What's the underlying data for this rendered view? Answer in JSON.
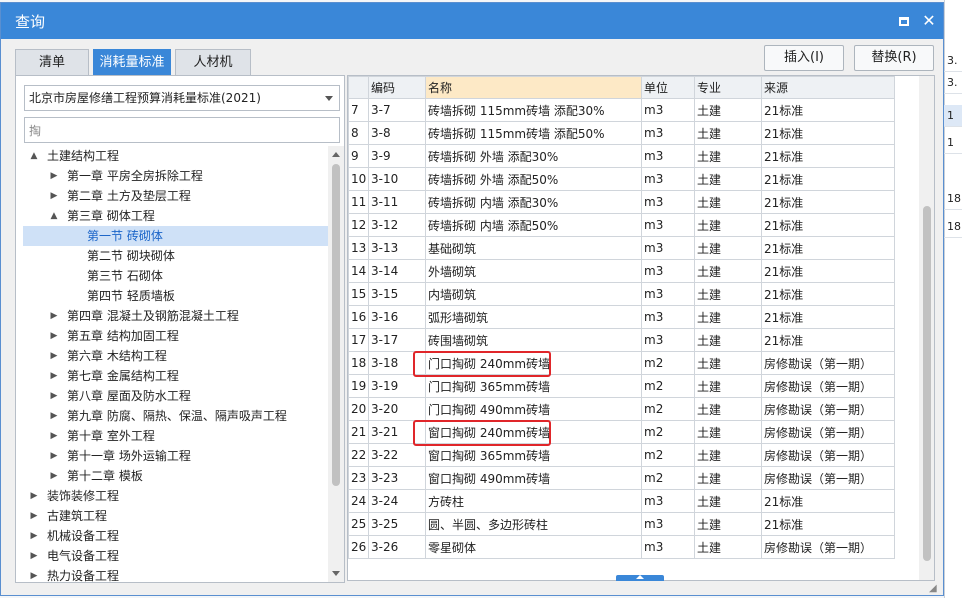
{
  "window": {
    "title": "查询"
  },
  "tabs": [
    {
      "label": "清单",
      "active": false
    },
    {
      "label": "消耗量标准",
      "active": true
    },
    {
      "label": "人材机",
      "active": false
    }
  ],
  "actions": {
    "insert_label": "插入(I)",
    "replace_label": "替换(R)"
  },
  "left": {
    "standard_select": "北京市房屋修缮工程预算消耗量标准(2021)",
    "search_value": "掏",
    "tree": [
      {
        "label": "土建结构工程",
        "level": 0,
        "toggle": "▲",
        "selected": false
      },
      {
        "label": "第一章 平房全房拆除工程",
        "level": 1,
        "toggle": "▶",
        "selected": false
      },
      {
        "label": "第二章 土方及垫层工程",
        "level": 1,
        "toggle": "▶",
        "selected": false
      },
      {
        "label": "第三章 砌体工程",
        "level": 1,
        "toggle": "▲",
        "selected": false
      },
      {
        "label": "第一节 砖砌体",
        "level": 2,
        "toggle": "",
        "selected": true
      },
      {
        "label": "第二节 砌块砌体",
        "level": 2,
        "toggle": "",
        "selected": false
      },
      {
        "label": "第三节 石砌体",
        "level": 2,
        "toggle": "",
        "selected": false
      },
      {
        "label": "第四节 轻质墙板",
        "level": 2,
        "toggle": "",
        "selected": false
      },
      {
        "label": "第四章 混凝土及钢筋混凝土工程",
        "level": 1,
        "toggle": "▶",
        "selected": false
      },
      {
        "label": "第五章 结构加固工程",
        "level": 1,
        "toggle": "▶",
        "selected": false
      },
      {
        "label": "第六章 木结构工程",
        "level": 1,
        "toggle": "▶",
        "selected": false
      },
      {
        "label": "第七章 金属结构工程",
        "level": 1,
        "toggle": "▶",
        "selected": false
      },
      {
        "label": "第八章 屋面及防水工程",
        "level": 1,
        "toggle": "▶",
        "selected": false
      },
      {
        "label": "第九章 防腐、隔热、保温、隔声吸声工程",
        "level": 1,
        "toggle": "▶",
        "selected": false
      },
      {
        "label": "第十章 室外工程",
        "level": 1,
        "toggle": "▶",
        "selected": false
      },
      {
        "label": "第十一章 场外运输工程",
        "level": 1,
        "toggle": "▶",
        "selected": false
      },
      {
        "label": "第十二章 模板",
        "level": 1,
        "toggle": "▶",
        "selected": false
      },
      {
        "label": "装饰装修工程",
        "level": 0,
        "toggle": "▶",
        "selected": false
      },
      {
        "label": "古建筑工程",
        "level": 0,
        "toggle": "▶",
        "selected": false
      },
      {
        "label": "机械设备工程",
        "level": 0,
        "toggle": "▶",
        "selected": false
      },
      {
        "label": "电气设备工程",
        "level": 0,
        "toggle": "▶",
        "selected": false
      },
      {
        "label": "热力设备工程",
        "level": 0,
        "toggle": "▶",
        "selected": false
      }
    ]
  },
  "table": {
    "columns": [
      "",
      "编码",
      "名称",
      "单位",
      "专业",
      "来源"
    ],
    "rows": [
      {
        "idx": "7",
        "code": "3-7",
        "name": "砖墙拆砌 115mm砖墙 添配30%",
        "unit": "m3",
        "major": "土建",
        "source": "21标准",
        "highlight": false
      },
      {
        "idx": "8",
        "code": "3-8",
        "name": "砖墙拆砌 115mm砖墙 添配50%",
        "unit": "m3",
        "major": "土建",
        "source": "21标准",
        "highlight": false
      },
      {
        "idx": "9",
        "code": "3-9",
        "name": "砖墙拆砌 外墙 添配30%",
        "unit": "m3",
        "major": "土建",
        "source": "21标准",
        "highlight": false
      },
      {
        "idx": "10",
        "code": "3-10",
        "name": "砖墙拆砌 外墙 添配50%",
        "unit": "m3",
        "major": "土建",
        "source": "21标准",
        "highlight": false
      },
      {
        "idx": "11",
        "code": "3-11",
        "name": "砖墙拆砌 内墙 添配30%",
        "unit": "m3",
        "major": "土建",
        "source": "21标准",
        "highlight": false
      },
      {
        "idx": "12",
        "code": "3-12",
        "name": "砖墙拆砌 内墙 添配50%",
        "unit": "m3",
        "major": "土建",
        "source": "21标准",
        "highlight": false
      },
      {
        "idx": "13",
        "code": "3-13",
        "name": "基础砌筑",
        "unit": "m3",
        "major": "土建",
        "source": "21标准",
        "highlight": false
      },
      {
        "idx": "14",
        "code": "3-14",
        "name": "外墙砌筑",
        "unit": "m3",
        "major": "土建",
        "source": "21标准",
        "highlight": false
      },
      {
        "idx": "15",
        "code": "3-15",
        "name": "内墙砌筑",
        "unit": "m3",
        "major": "土建",
        "source": "21标准",
        "highlight": false
      },
      {
        "idx": "16",
        "code": "3-16",
        "name": "弧形墙砌筑",
        "unit": "m3",
        "major": "土建",
        "source": "21标准",
        "highlight": false
      },
      {
        "idx": "17",
        "code": "3-17",
        "name": "砖围墙砌筑",
        "unit": "m3",
        "major": "土建",
        "source": "21标准",
        "highlight": false
      },
      {
        "idx": "18",
        "code": "3-18",
        "name": "门口掏砌 240mm砖墙",
        "unit": "m2",
        "major": "土建",
        "source": "房修勘误（第一期）",
        "highlight": true
      },
      {
        "idx": "19",
        "code": "3-19",
        "name": "门口掏砌 365mm砖墙",
        "unit": "m2",
        "major": "土建",
        "source": "房修勘误（第一期）",
        "highlight": false
      },
      {
        "idx": "20",
        "code": "3-20",
        "name": "门口掏砌 490mm砖墙",
        "unit": "m2",
        "major": "土建",
        "source": "房修勘误（第一期）",
        "highlight": false
      },
      {
        "idx": "21",
        "code": "3-21",
        "name": "窗口掏砌 240mm砖墙",
        "unit": "m2",
        "major": "土建",
        "source": "房修勘误（第一期）",
        "highlight": true
      },
      {
        "idx": "22",
        "code": "3-22",
        "name": "窗口掏砌 365mm砖墙",
        "unit": "m2",
        "major": "土建",
        "source": "房修勘误（第一期）",
        "highlight": false
      },
      {
        "idx": "23",
        "code": "3-23",
        "name": "窗口掏砌 490mm砖墙",
        "unit": "m2",
        "major": "土建",
        "source": "房修勘误（第一期）",
        "highlight": false
      },
      {
        "idx": "24",
        "code": "3-24",
        "name": "方砖柱",
        "unit": "m3",
        "major": "土建",
        "source": "21标准",
        "highlight": false
      },
      {
        "idx": "25",
        "code": "3-25",
        "name": "圆、半圆、多边形砖柱",
        "unit": "m3",
        "major": "土建",
        "source": "21标准",
        "highlight": false
      },
      {
        "idx": "26",
        "code": "3-26",
        "name": "零星砌体",
        "unit": "m3",
        "major": "土建",
        "source": "房修勘误（第一期）",
        "highlight": false
      }
    ]
  },
  "background": {
    "cells": [
      "3.",
      "3.",
      "1",
      "1",
      "18",
      "18"
    ]
  },
  "colors": {
    "titlebar": "#3a87d8",
    "highlight_box": "#e0262a",
    "selected_tree": "#cfe1f7"
  }
}
